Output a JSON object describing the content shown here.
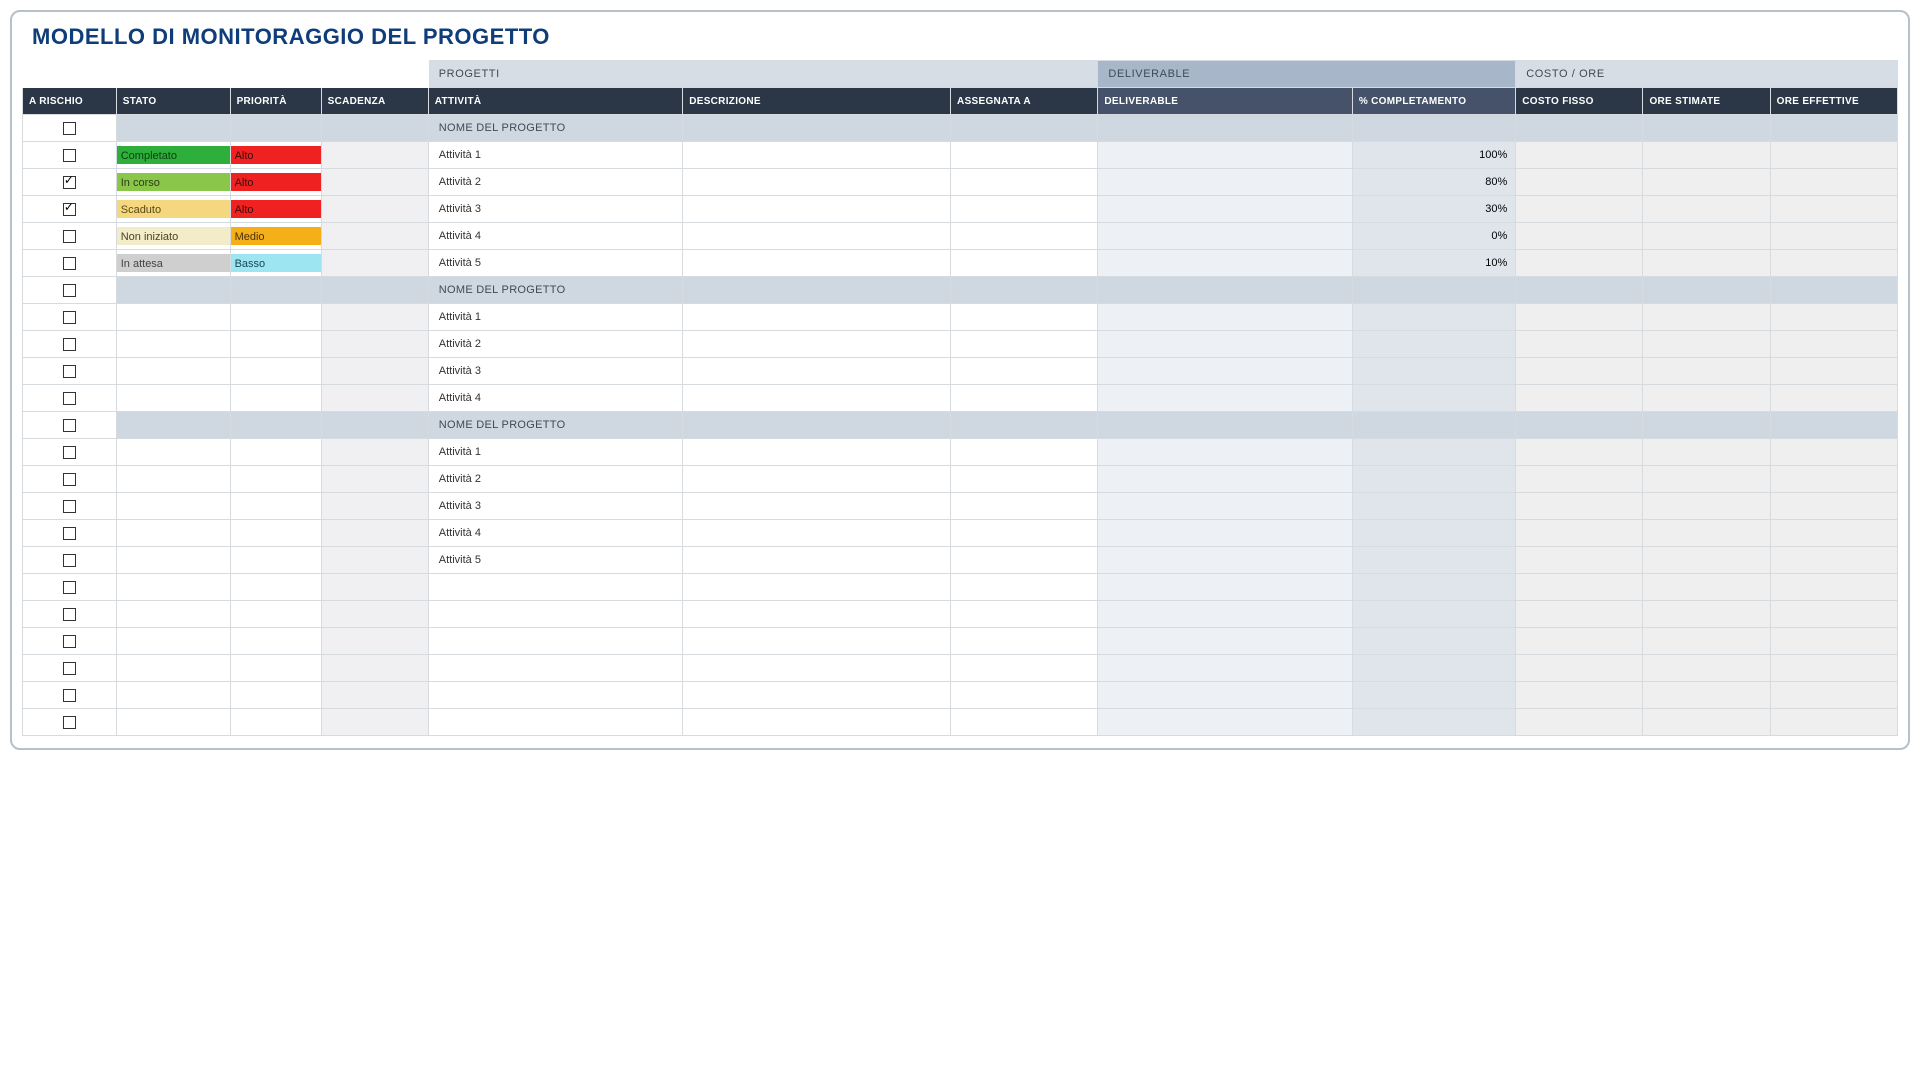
{
  "title": "MODELLO DI MONITORAGGIO DEL PROGETTO",
  "super": {
    "progetti": "PROGETTI",
    "deliverable": "DELIVERABLE",
    "costo": "COSTO / ORE"
  },
  "headers": {
    "risk": "A RISCHIO",
    "status": "STATO",
    "prio": "PRIORITÀ",
    "dead": "SCADENZA",
    "act": "ATTIVITÀ",
    "desc": "DESCRIZIONE",
    "assign": "ASSEGNATA A",
    "deliv": "DELIVERABLE",
    "comp": "% COMPLETAMENTO",
    "cost": "COSTO FISSO",
    "hours": "ORE STIMATE",
    "eff": "ORE EFFETTIVE"
  },
  "labels": {
    "section": "NOME DEL PROGETTO",
    "status": {
      "completato": "Completato",
      "incorso": "In corso",
      "scaduto": "Scaduto",
      "noniniziato": "Non iniziato",
      "inattesa": "In attesa"
    },
    "prio": {
      "alto": "Alto",
      "medio": "Medio",
      "basso": "Basso"
    }
  },
  "rows": [
    {
      "type": "section"
    },
    {
      "type": "data",
      "risk": false,
      "status": "completato",
      "prio": "alto",
      "act": "Attività 1",
      "comp": "100%"
    },
    {
      "type": "data",
      "risk": true,
      "status": "incorso",
      "prio": "alto",
      "act": "Attività 2",
      "comp": "80%"
    },
    {
      "type": "data",
      "risk": true,
      "status": "scaduto",
      "prio": "alto",
      "act": "Attività 3",
      "comp": "30%"
    },
    {
      "type": "data",
      "risk": false,
      "status": "noniniziato",
      "prio": "medio",
      "act": "Attività 4",
      "comp": "0%"
    },
    {
      "type": "data",
      "risk": false,
      "status": "inattesa",
      "prio": "basso",
      "act": "Attività 5",
      "comp": "10%"
    },
    {
      "type": "section"
    },
    {
      "type": "data",
      "risk": false,
      "act": "Attività 1"
    },
    {
      "type": "data",
      "risk": false,
      "act": "Attività 2"
    },
    {
      "type": "data",
      "risk": false,
      "act": "Attività 3"
    },
    {
      "type": "data",
      "risk": false,
      "act": "Attività 4"
    },
    {
      "type": "section"
    },
    {
      "type": "data",
      "risk": false,
      "act": "Attività 1"
    },
    {
      "type": "data",
      "risk": false,
      "act": "Attività 2"
    },
    {
      "type": "data",
      "risk": false,
      "act": "Attività 3"
    },
    {
      "type": "data",
      "risk": false,
      "act": "Attività 4"
    },
    {
      "type": "data",
      "risk": false,
      "act": "Attività 5"
    },
    {
      "type": "data",
      "risk": false
    },
    {
      "type": "data",
      "risk": false
    },
    {
      "type": "data",
      "risk": false
    },
    {
      "type": "data",
      "risk": false
    },
    {
      "type": "data",
      "risk": false
    },
    {
      "type": "data",
      "risk": false
    }
  ]
}
